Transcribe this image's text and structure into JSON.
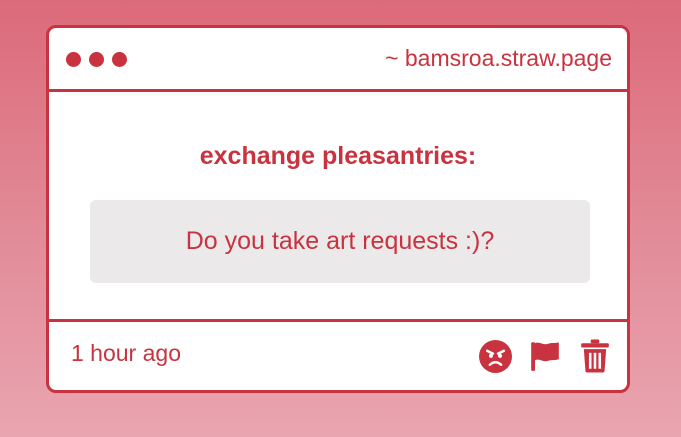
{
  "window": {
    "url": "~ bamsroa.straw.page"
  },
  "card": {
    "heading": "exchange pleasantries:",
    "message": "Do you take art requests :)?",
    "timestamp": "1 hour ago"
  },
  "actions": [
    {
      "icon": "angry-face-icon"
    },
    {
      "icon": "flag-icon"
    },
    {
      "icon": "trash-icon"
    }
  ],
  "colors": {
    "accent": "#c8333f",
    "background_top": "#dc6a7a",
    "background_bottom": "#e9a5b0",
    "message_bg": "#ebe9ea"
  }
}
